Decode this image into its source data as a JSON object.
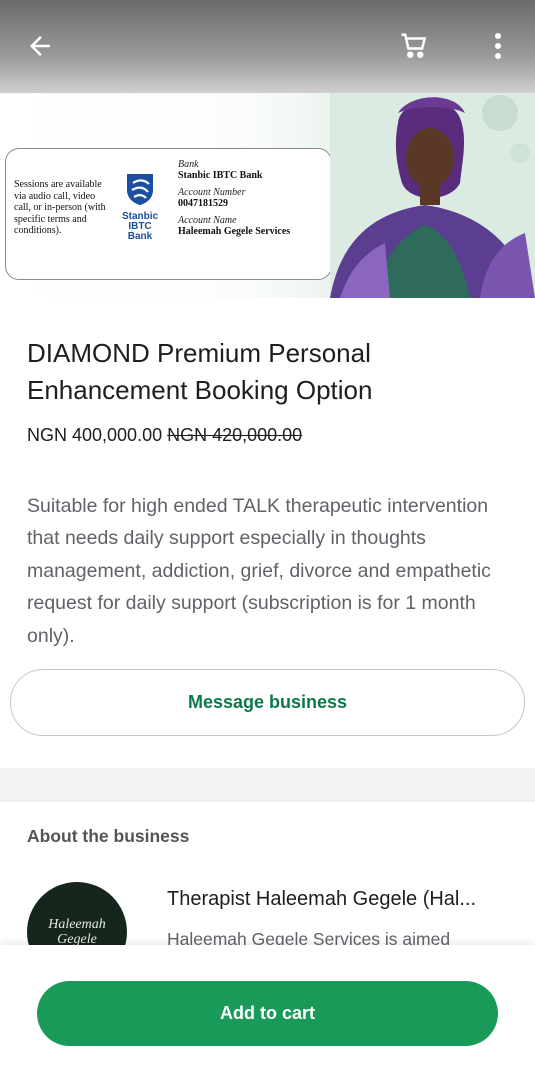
{
  "header": {
    "back_icon": "arrow-left-icon",
    "cart_icon": "shopping-cart-icon",
    "more_icon": "more-vertical-icon"
  },
  "banner": {
    "sessions_text": "Sessions are available via audio call, video call, or in-person (with specific terms and conditions).",
    "bank_logo_text": [
      "Stanbic",
      "IBTC",
      "Bank"
    ],
    "bank_label": "Bank",
    "bank_value": "Stanbic IBTC Bank",
    "account_number_label": "Account Number",
    "account_number_value": "0047181529",
    "account_name_label": "Account Name",
    "account_name_value": "Haleemah Gegele Services"
  },
  "product": {
    "title": "DIAMOND Premium Personal Enhancement Booking Option",
    "price": "NGN 400,000.00",
    "old_price": "NGN 420,000.00",
    "description": "Suitable for high ended TALK therapeutic intervention that needs daily support especially in thoughts management, addiction, grief, divorce and empathetic request for daily support (subscription is for 1 month only)."
  },
  "actions": {
    "message_label": "Message business",
    "add_to_cart_label": "Add to cart"
  },
  "about": {
    "heading": "About the business",
    "logo_text": [
      "Haleemah",
      "Gegele"
    ],
    "business_name": "Therapist Haleemah Gegele (Hal...",
    "business_desc": "Haleemah Gegele Services is aimed"
  },
  "colors": {
    "accent": "#1a9a58",
    "accent_text": "#0a7a4a"
  }
}
